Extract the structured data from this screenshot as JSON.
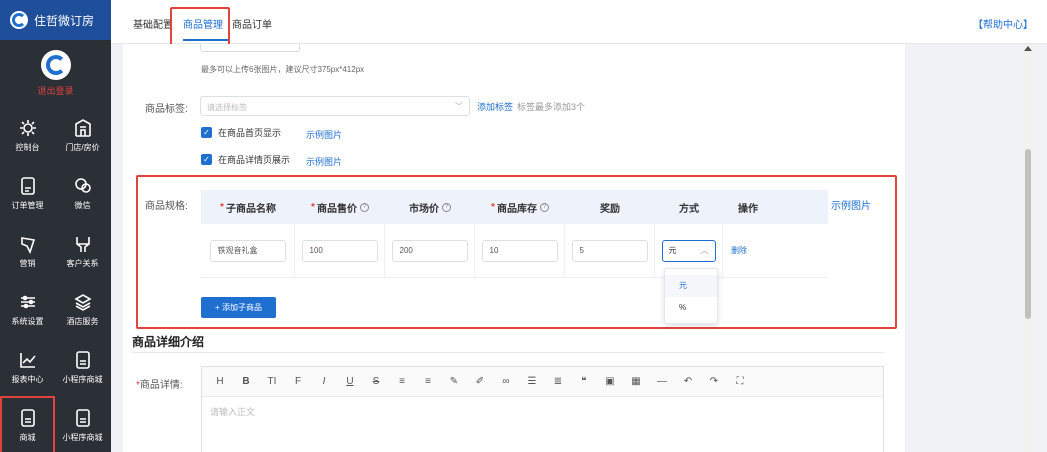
{
  "brand": {
    "name": "住哲微订房"
  },
  "user": {
    "logout": "退出登录"
  },
  "nav": [
    {
      "label": "控制台",
      "icon": "dashboard-icon"
    },
    {
      "label": "门店/房价",
      "icon": "hotel-icon"
    },
    {
      "label": "订单管理",
      "icon": "order-icon"
    },
    {
      "label": "微信",
      "icon": "wechat-icon"
    },
    {
      "label": "营销",
      "icon": "marketing-icon"
    },
    {
      "label": "客户关系",
      "icon": "customer-icon"
    },
    {
      "label": "系统设置",
      "icon": "settings-icon"
    },
    {
      "label": "酒店服务",
      "icon": "layers-icon"
    },
    {
      "label": "报表中心",
      "icon": "chart-icon"
    },
    {
      "label": "小程序商城",
      "icon": "document-icon"
    },
    {
      "label": "商城",
      "icon": "document-icon"
    },
    {
      "label": "小程序商城",
      "icon": "document-icon"
    }
  ],
  "tabs": [
    "基础配置",
    "商品管理",
    "商品订单"
  ],
  "help": "【帮助中心】",
  "form": {
    "upload_hint": "最多可以上传6张图片，建议尺寸375px*412px",
    "tag_label": "商品标签:",
    "tag_placeholder": "请选择标签",
    "add_tag": "添加标签",
    "tag_tip": "标签最多添加3个",
    "show_home": "在商品首页显示",
    "show_detail": "在商品详情页展示",
    "example_link": "示例图片",
    "spec_label": "商品规格:",
    "spec_headers": [
      "子商品名称",
      "商品售价",
      "市场价",
      "商品库存",
      "奖励",
      "方式",
      "操作"
    ],
    "spec_row": {
      "name": "铁观音礼盒",
      "price": "100",
      "market": "200",
      "stock": "10",
      "reward": "5",
      "mode": "元",
      "action": "删除"
    },
    "mode_options": [
      "元",
      "%"
    ],
    "add_child": "+ 添加子商品",
    "detail_title": "商品详细介绍",
    "detail_label": "商品详情:",
    "detail_placeholder": "请输入正文"
  },
  "colors": {
    "accent": "#1f6fd1",
    "highlight": "#e0443e",
    "sidebar": "#2b2f36"
  }
}
